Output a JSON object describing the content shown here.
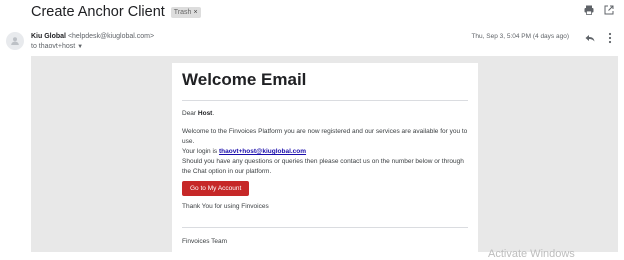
{
  "email": {
    "subject": "Create Anchor Client",
    "label": "Trash",
    "label_remove": "×",
    "sender_name": "Kiu Global",
    "sender_email": "<helpdesk@kiuglobal.com>",
    "to_line": "to thaovt+host",
    "date": "Thu, Sep 3, 5:04 PM (4 days ago)"
  },
  "content": {
    "title": "Welcome Email",
    "greeting_prefix": "Dear ",
    "greeting_name": "Host",
    "greeting_suffix": ".",
    "para1": "Welcome to the Finvoices Platform you are now registered and our services are available for you to use.",
    "login_prefix": "Your login is ",
    "login_email": "thaovt+host@kiuglobal.com",
    "para2": "Should you have any questions or queries then please contact us on the number below or through the Chat option in our platform.",
    "cta_label": "Go to My Account",
    "thanks": "Thank You for using Finvoices",
    "signoff": "Finvoices Team"
  },
  "overlay": {
    "watermark": "Activate Windows"
  },
  "icons": {
    "print": "print-icon",
    "open_new_window": "open-in-new-icon",
    "reply": "reply-icon",
    "more": "more-vertical-icon",
    "avatar": "person-icon"
  },
  "colors": {
    "cta_bg": "#c62828",
    "link": "#1a0dab"
  }
}
